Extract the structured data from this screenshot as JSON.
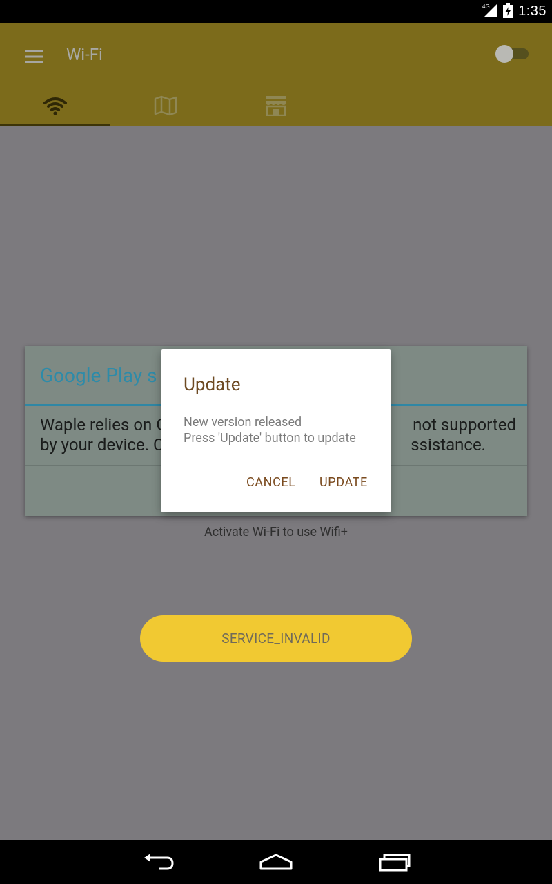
{
  "status_bar": {
    "network": "4G",
    "time": "1:35",
    "icons": [
      "signal-icon",
      "battery-icon"
    ]
  },
  "app_bar": {
    "title": "Wi-Fi",
    "menu_icon": "hamburger-menu-icon",
    "toggle_on": false,
    "tabs": [
      {
        "icon": "wifi-icon",
        "selected": true
      },
      {
        "icon": "map-icon",
        "selected": false
      },
      {
        "icon": "store-icon",
        "selected": false
      }
    ]
  },
  "main": {
    "activate_text": "Activate Wi-Fi to use Wifi+",
    "service_button": "SERVICE_INVALID"
  },
  "google_play_dialog": {
    "title": "Google Play s",
    "body_line1_left": "Waple relies on G",
    "body_line1_right": "not supported",
    "body_line2_left": "by your device. C",
    "body_line2_right": "ssistance."
  },
  "update_dialog": {
    "title": "Update",
    "message_line1": "New version released",
    "message_line2": "Press 'Update' button to update",
    "cancel_label": "CANCEL",
    "update_label": "UPDATE"
  },
  "nav_bar": {
    "buttons": [
      "back-icon",
      "home-icon",
      "recents-icon"
    ]
  },
  "colors": {
    "app_bar": "#7c6b1b",
    "scrim_background": "#7c7a7e",
    "service_button": "#f1c932",
    "dialog_accent": "#6e4a23",
    "google_play_title": "#2d8ba9"
  }
}
